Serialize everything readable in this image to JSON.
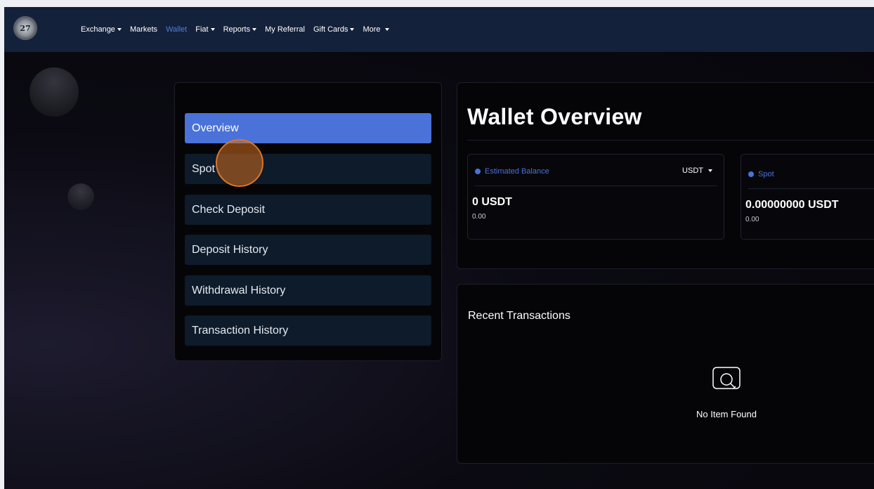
{
  "nav": {
    "logo_text": "27",
    "items": [
      {
        "label": "Exchange",
        "has_caret": true,
        "active": false
      },
      {
        "label": "Markets",
        "has_caret": false,
        "active": false
      },
      {
        "label": "Wallet",
        "has_caret": false,
        "active": true
      },
      {
        "label": "Fiat",
        "has_caret": true,
        "active": false
      },
      {
        "label": "Reports",
        "has_caret": true,
        "active": false
      },
      {
        "label": "My Referral",
        "has_caret": false,
        "active": false
      },
      {
        "label": "Gift Cards",
        "has_caret": true,
        "active": false
      },
      {
        "label": "More",
        "has_caret": true,
        "active": false
      }
    ]
  },
  "sidebar": {
    "items": [
      {
        "label": "Overview",
        "active": true
      },
      {
        "label": "Spot",
        "active": false
      },
      {
        "label": "Check Deposit",
        "active": false
      },
      {
        "label": "Deposit History",
        "active": false
      },
      {
        "label": "Withdrawal History",
        "active": false
      },
      {
        "label": "Transaction History",
        "active": false
      }
    ]
  },
  "overview": {
    "title": "Wallet Overview",
    "cards": [
      {
        "label": "Estimated Balance",
        "currency": "USDT",
        "amount": "0 USDT",
        "sub": "0.00"
      },
      {
        "label": "Spot",
        "amount": "0.00000000 USDT",
        "sub": "0.00"
      }
    ]
  },
  "transactions": {
    "title": "Recent Transactions",
    "empty_text": "No Item Found"
  },
  "colors": {
    "accent": "#4a72d9",
    "nav_bg": "#14213a",
    "menu_bg": "#0d1b2a",
    "click_marker": "#d9772a"
  }
}
